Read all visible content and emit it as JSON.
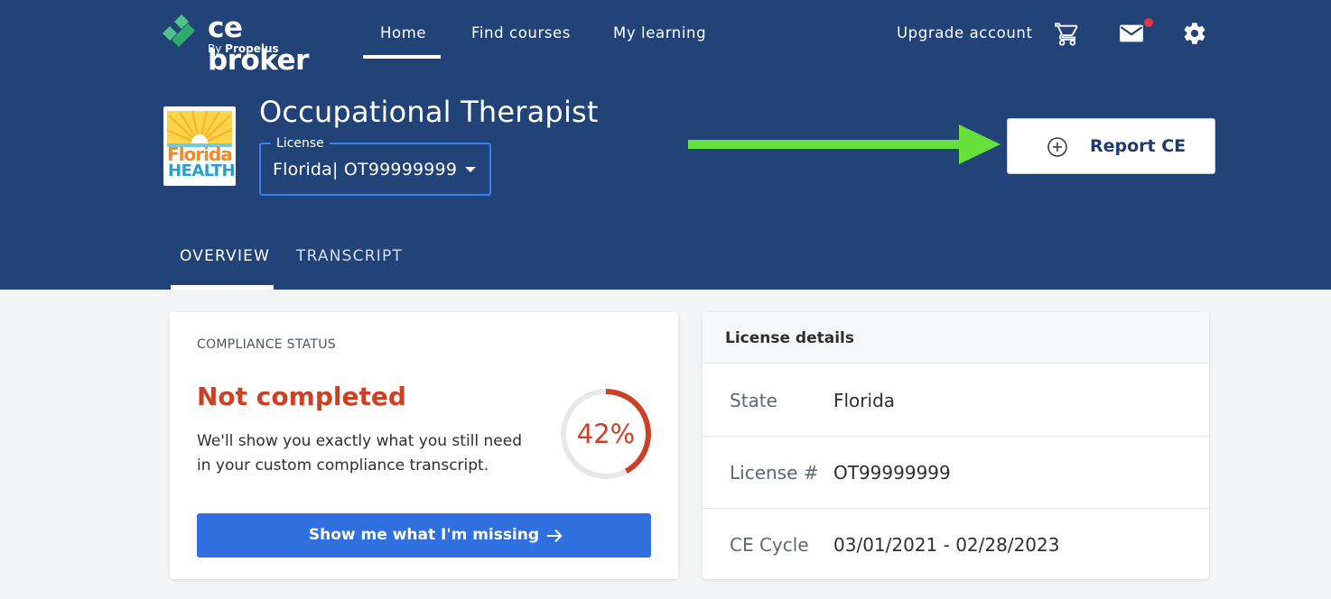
{
  "brand": {
    "name": "ce broker",
    "by": "By",
    "company": "Propelus"
  },
  "nav": {
    "home": "Home",
    "find_courses": "Find courses",
    "my_learning": "My learning",
    "upgrade": "Upgrade account",
    "cart_icon": "cart-icon",
    "mail_icon": "mail-icon",
    "settings_icon": "gear-icon"
  },
  "license": {
    "board_logo_line1": "Florida",
    "board_logo_line2": "HEALTH",
    "profession": "Occupational Therapist",
    "select_label": "License",
    "select_value": "Florida| OT99999999"
  },
  "actions": {
    "report_ce": "Report CE"
  },
  "tabs": [
    "OVERVIEW",
    "TRANSCRIPT"
  ],
  "compliance": {
    "label": "COMPLIANCE STATUS",
    "status": "Not completed",
    "description": "We'll show you exactly what you still need in your custom compliance transcript.",
    "percent_text": "42%",
    "percent_value": 42,
    "button": "Show me what I'm missing"
  },
  "details": {
    "title": "License details",
    "rows": [
      {
        "label": "State",
        "value": "Florida"
      },
      {
        "label": "License #",
        "value": "OT99999999"
      },
      {
        "label": "CE Cycle",
        "value": "03/01/2021 - 02/28/2023"
      }
    ]
  },
  "colors": {
    "header_bg": "#214377",
    "status_red": "#cc4026",
    "primary_blue": "#2f6fde",
    "arrow_green": "#66e03a",
    "notification_dot": "#e5364a"
  }
}
